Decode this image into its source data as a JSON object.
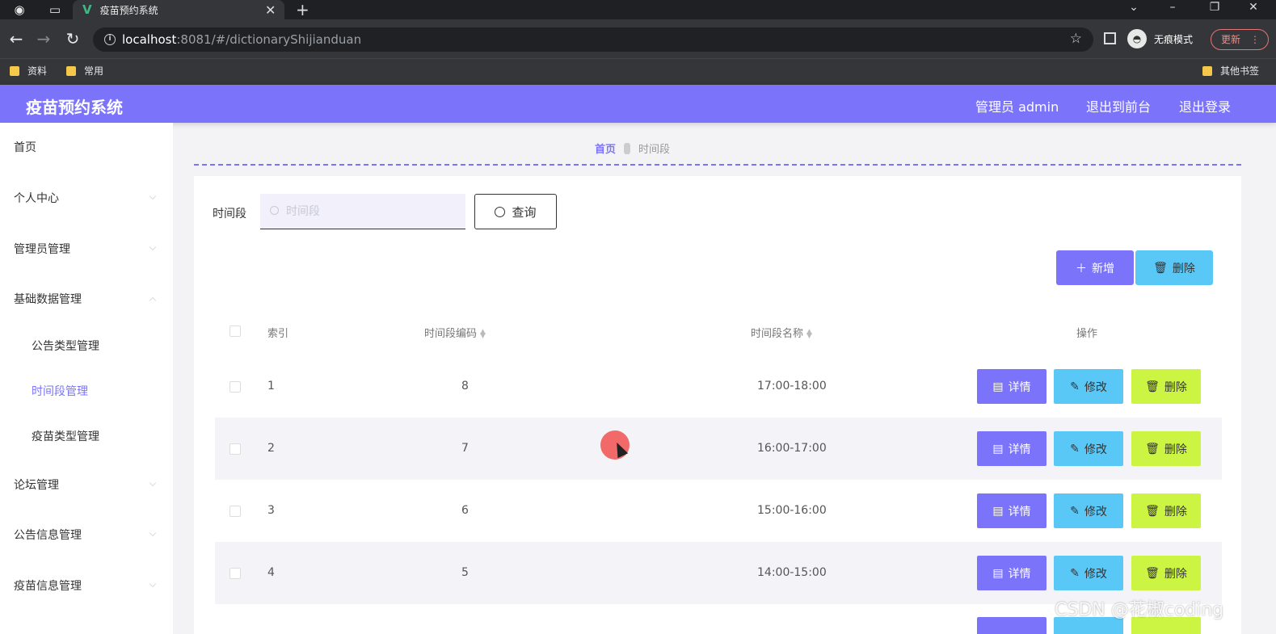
{
  "browser": {
    "tab_title": "疫苗预约系统",
    "url_host": "localhost",
    "url_rest": ":8081/#/dictionaryShijianduan",
    "incognito_label": "无痕模式",
    "update_label": "更新",
    "bookmarks": [
      "资料",
      "常用"
    ],
    "other_bookmarks": "其他书签"
  },
  "header": {
    "title": "疫苗预约系统",
    "user": "管理员 admin",
    "exit_front": "退出到前台",
    "logout": "退出登录"
  },
  "sidebar": {
    "items": [
      {
        "label": "首页"
      },
      {
        "label": "个人中心"
      },
      {
        "label": "管理员管理"
      },
      {
        "label": "基础数据管理"
      },
      {
        "label": "公告类型管理"
      },
      {
        "label": "时间段管理"
      },
      {
        "label": "疫苗类型管理"
      },
      {
        "label": "论坛管理"
      },
      {
        "label": "公告信息管理"
      },
      {
        "label": "疫苗信息管理"
      }
    ]
  },
  "breadcrumb": {
    "home": "首页",
    "current": "时间段"
  },
  "search": {
    "label": "时间段",
    "placeholder": "时间段",
    "button": "查询"
  },
  "toolbar": {
    "add": "新增",
    "delete": "删除"
  },
  "table": {
    "columns": [
      "索引",
      "时间段编码",
      "时间段名称",
      "操作"
    ],
    "rows": [
      {
        "index": "1",
        "code": "8",
        "name": "17:00-18:00"
      },
      {
        "index": "2",
        "code": "7",
        "name": "16:00-17:00"
      },
      {
        "index": "3",
        "code": "6",
        "name": "15:00-16:00"
      },
      {
        "index": "4",
        "code": "5",
        "name": "14:00-15:00"
      }
    ],
    "actions": {
      "detail": "详情",
      "edit": "修改",
      "remove": "删除"
    }
  },
  "watermark": "CSDN @花椒coding",
  "colors": {
    "primary": "#7b74fb",
    "info": "#5ac8f7",
    "lime": "#cbf542"
  }
}
